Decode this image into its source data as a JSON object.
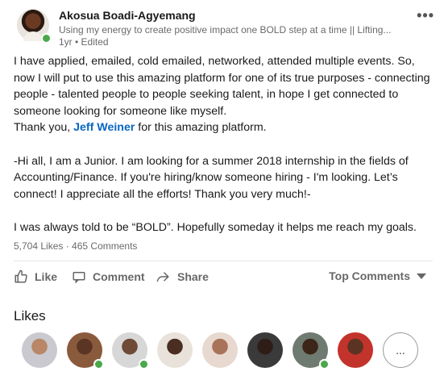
{
  "post": {
    "author": "Akosua Boadi-Agyemang",
    "headline": "Using my energy to create positive impact one BOLD step at a time || Lifting...",
    "meta": "1yr • Edited",
    "more_icon": "more-horizontal-icon",
    "body": {
      "p1": "I have applied, emailed, cold emailed, networked, attended multiple events. So, now I will put to use this amazing platform for one of its true purposes - connecting people - talented people to people seeking talent, in hope I get connected to someone looking for someone like myself.",
      "thanks_prefix": "Thank you, ",
      "mention": "Jeff Weiner",
      "thanks_suffix": " for this amazing platform.",
      "p2": "-Hi all, I am a Junior. I am looking for a summer 2018 internship in the fields of Accounting/Finance. If you're hiring/know someone hiring - I'm looking. Let’s connect! I appreciate all the efforts! Thank you very much!-",
      "p3": "I was always told to be “BOLD”. Hopefully someday it helps me reach my goals."
    },
    "stats": "5,704 Likes · 465 Comments"
  },
  "actions": {
    "like": "Like",
    "comment": "Comment",
    "share": "Share",
    "sort": "Top Comments"
  },
  "likes_section": {
    "title": "Likes",
    "more": "...",
    "avatars": [
      {
        "bg": "#c9c9cf",
        "skin": "#b98667",
        "online": false
      },
      {
        "bg": "#8a5a3c",
        "skin": "#5a3524",
        "online": true
      },
      {
        "bg": "#d7d7d7",
        "skin": "#6f4a36",
        "online": true
      },
      {
        "bg": "#e9e2da",
        "skin": "#4a2e22",
        "online": false
      },
      {
        "bg": "#e7d9cf",
        "skin": "#a9735a",
        "online": false
      },
      {
        "bg": "#3a3a3a",
        "skin": "#2e1d16",
        "online": false
      },
      {
        "bg": "#6f7a70",
        "skin": "#3b2619",
        "online": true
      },
      {
        "bg": "#c2332c",
        "skin": "#5b3322",
        "online": false
      }
    ]
  },
  "colors": {
    "accent": "#0a66c2",
    "online": "#4aa84a"
  }
}
